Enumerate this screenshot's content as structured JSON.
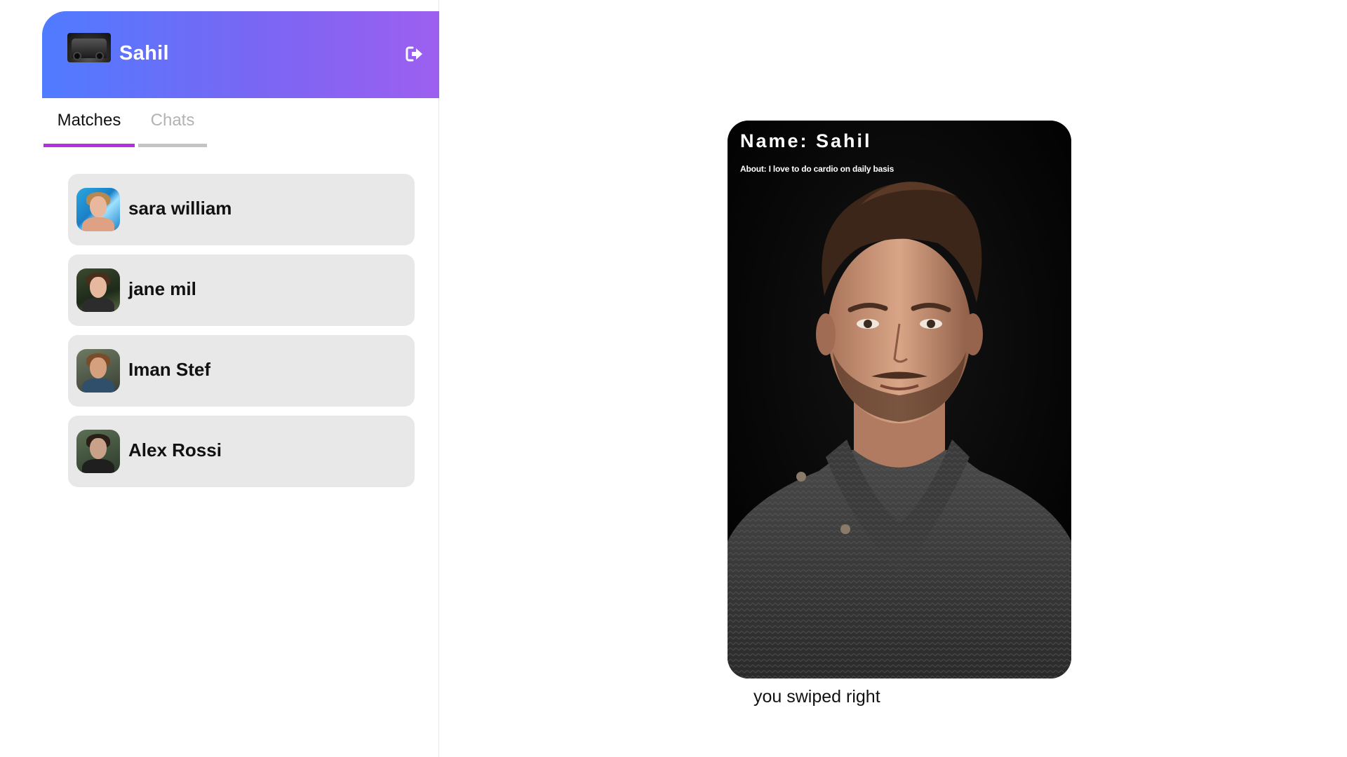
{
  "sidebar": {
    "user": {
      "name": "Sahil",
      "avatar_icon": "monster-truck-avatar"
    },
    "logout_icon": "sign-out-icon",
    "gradient": {
      "start": "#4f7bff",
      "end": "#9d5ff0"
    },
    "tabs": [
      {
        "label": "Matches",
        "active": true,
        "underline_color": "#b52fe0"
      },
      {
        "label": "Chats",
        "active": false,
        "underline_color": "#c4c4c4"
      }
    ],
    "matches": [
      {
        "name": "sara william",
        "avatar_icon": "profile-photo"
      },
      {
        "name": "jane mil",
        "avatar_icon": "profile-photo"
      },
      {
        "name": "Iman Stef",
        "avatar_icon": "profile-photo"
      },
      {
        "name": "Alex Rossi",
        "avatar_icon": "profile-photo"
      }
    ]
  },
  "card": {
    "name": "Name: Sahil",
    "about": "About: I love to do cardio on daily basis",
    "photo_icon": "profile-portrait"
  },
  "swipe_status": "you swiped right"
}
